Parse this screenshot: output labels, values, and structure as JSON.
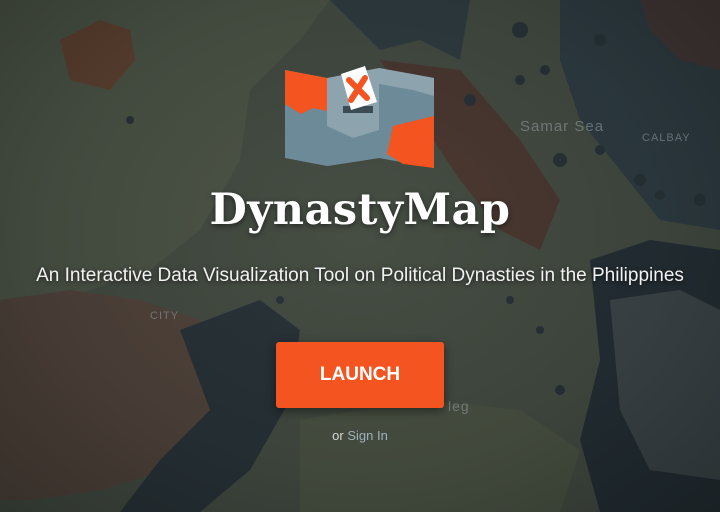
{
  "app": {
    "title": "DynastyMap",
    "subtitle": "An Interactive Data Visualization Tool on Political Dynasties in the Philippines"
  },
  "actions": {
    "launch_label": "LAUNCH",
    "or_text": "or",
    "signin_label": "Sign In"
  },
  "map_labels": {
    "samar_sea": "Samar Sea",
    "calbayog": "CALBAY",
    "city": "CITY",
    "bottom": "leg"
  },
  "colors": {
    "accent": "#f4541f",
    "logo_orange": "#f4541f",
    "logo_blue": "#6d8a99"
  },
  "icons": {
    "logo": "ballot-map-icon"
  }
}
